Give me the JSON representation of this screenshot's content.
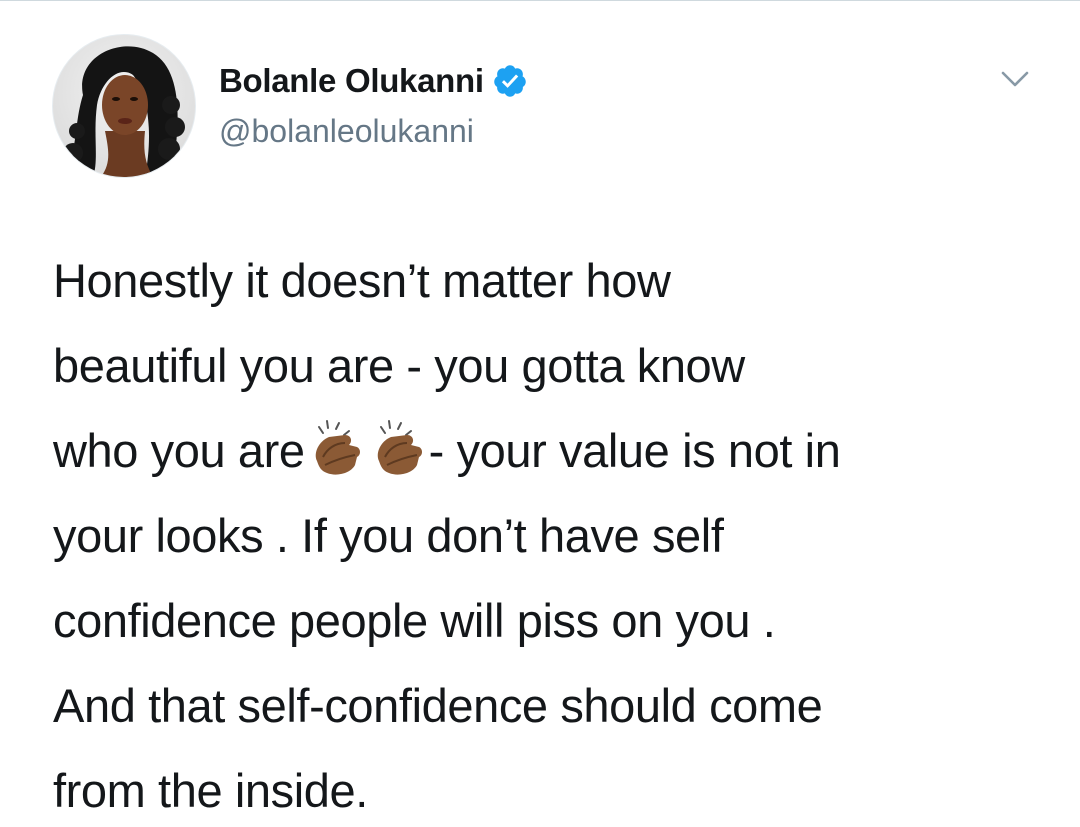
{
  "author": {
    "display_name": "Bolanle Olukanni",
    "handle": "@bolanleolukanni",
    "verified": true,
    "avatar": "profile-photo"
  },
  "menu": {
    "icon": "chevron-down-icon"
  },
  "colors": {
    "text": "#14171a",
    "handle": "#657786",
    "verified_badge": "#1da1f2",
    "divider": "#cfd9de"
  },
  "tweet": {
    "lines": [
      "Honestly it doesn’t matter how",
      "beautiful you are - you gotta know",
      "who you are",
      "- your value is not in",
      "your looks . If you don’t have self",
      "confidence people will piss on you .",
      "And that self-confidence should come",
      "from the inside."
    ],
    "emoji": [
      "clapping-hands-medium-dark-skin-tone",
      "clapping-hands-medium-dark-skin-tone"
    ]
  }
}
